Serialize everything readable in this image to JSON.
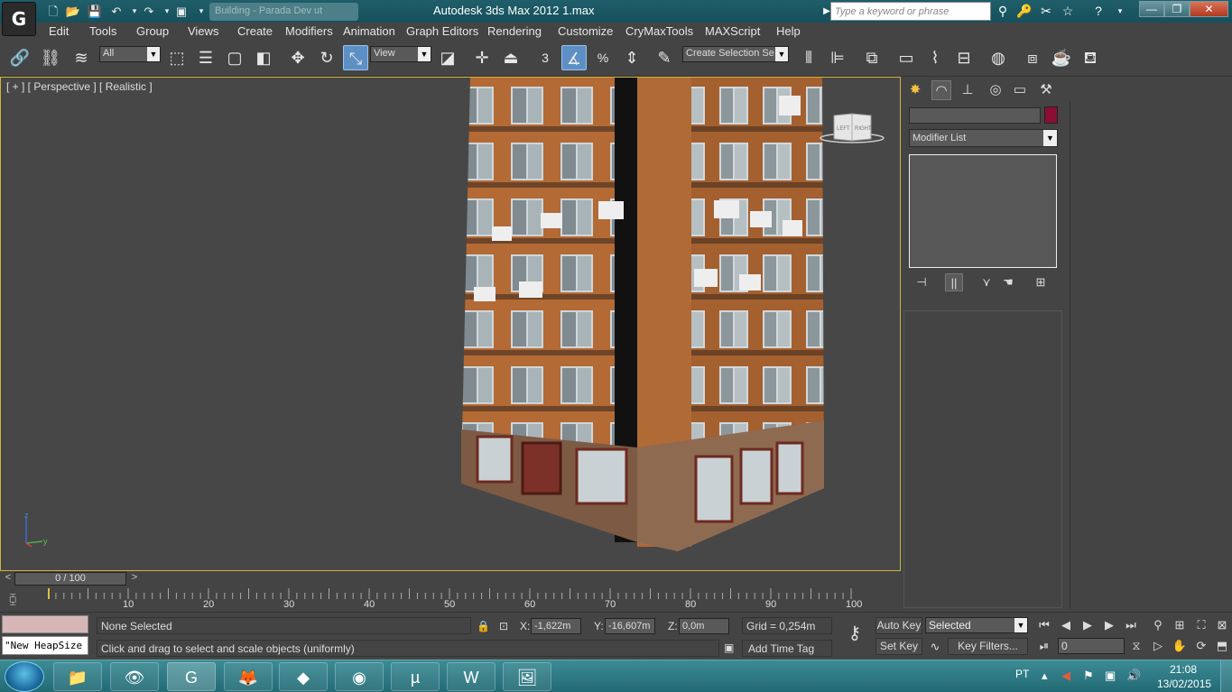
{
  "window": {
    "title": "Autodesk 3ds Max  2012       1.max",
    "doc_tab": "Building - Parada Dev ut",
    "help_search_placeholder": "Type a keyword or phrase",
    "controls": {
      "minimize": "—",
      "maximize": "❐",
      "close": "✕"
    }
  },
  "menu": [
    "Edit",
    "Tools",
    "Group",
    "Views",
    "Create",
    "Modifiers",
    "Animation",
    "Graph Editors",
    "Rendering",
    "Customize",
    "CryMaxTools",
    "MAXScript",
    "Help"
  ],
  "toolbar": {
    "selection_filter": "All",
    "ref_coord": "View",
    "named_selection": "Create Selection Se",
    "snap_label": "3",
    "percent_label": "%"
  },
  "viewport": {
    "label": "[ + ] [ Perspective ] [ Realistic ]",
    "viewcube_left": "LEFT",
    "viewcube_right": "RIGHT",
    "axis_z": "z",
    "axis_y": "y"
  },
  "command_panel": {
    "modifier_list": "Modifier List",
    "object_color": "#8c0e33"
  },
  "time": {
    "slider_label": "0 / 100",
    "current_frame": 0,
    "total_frames": 100,
    "tick_labels": [
      "0",
      "10",
      "20",
      "30",
      "40",
      "50",
      "60",
      "70",
      "80",
      "90",
      "100"
    ]
  },
  "status": {
    "selection": "None Selected",
    "prompt": "Click and drag to select and scale objects (uniformly)",
    "maxscript_listener": "\"New HeapSize",
    "x_label": "X:",
    "x_value": "-1,622m",
    "y_label": "Y:",
    "y_value": "-16,607m",
    "z_label": "Z:",
    "z_value": "0,0m",
    "grid": "Grid = 0,254m",
    "add_time_tag": "Add Time Tag",
    "auto_key": "Auto Key",
    "set_key": "Set Key",
    "key_mode": "Selected",
    "key_filters": "Key Filters...",
    "frame_value": "0"
  },
  "taskbar": {
    "language": "PT",
    "time": "21:08",
    "date": "13/02/2015"
  }
}
